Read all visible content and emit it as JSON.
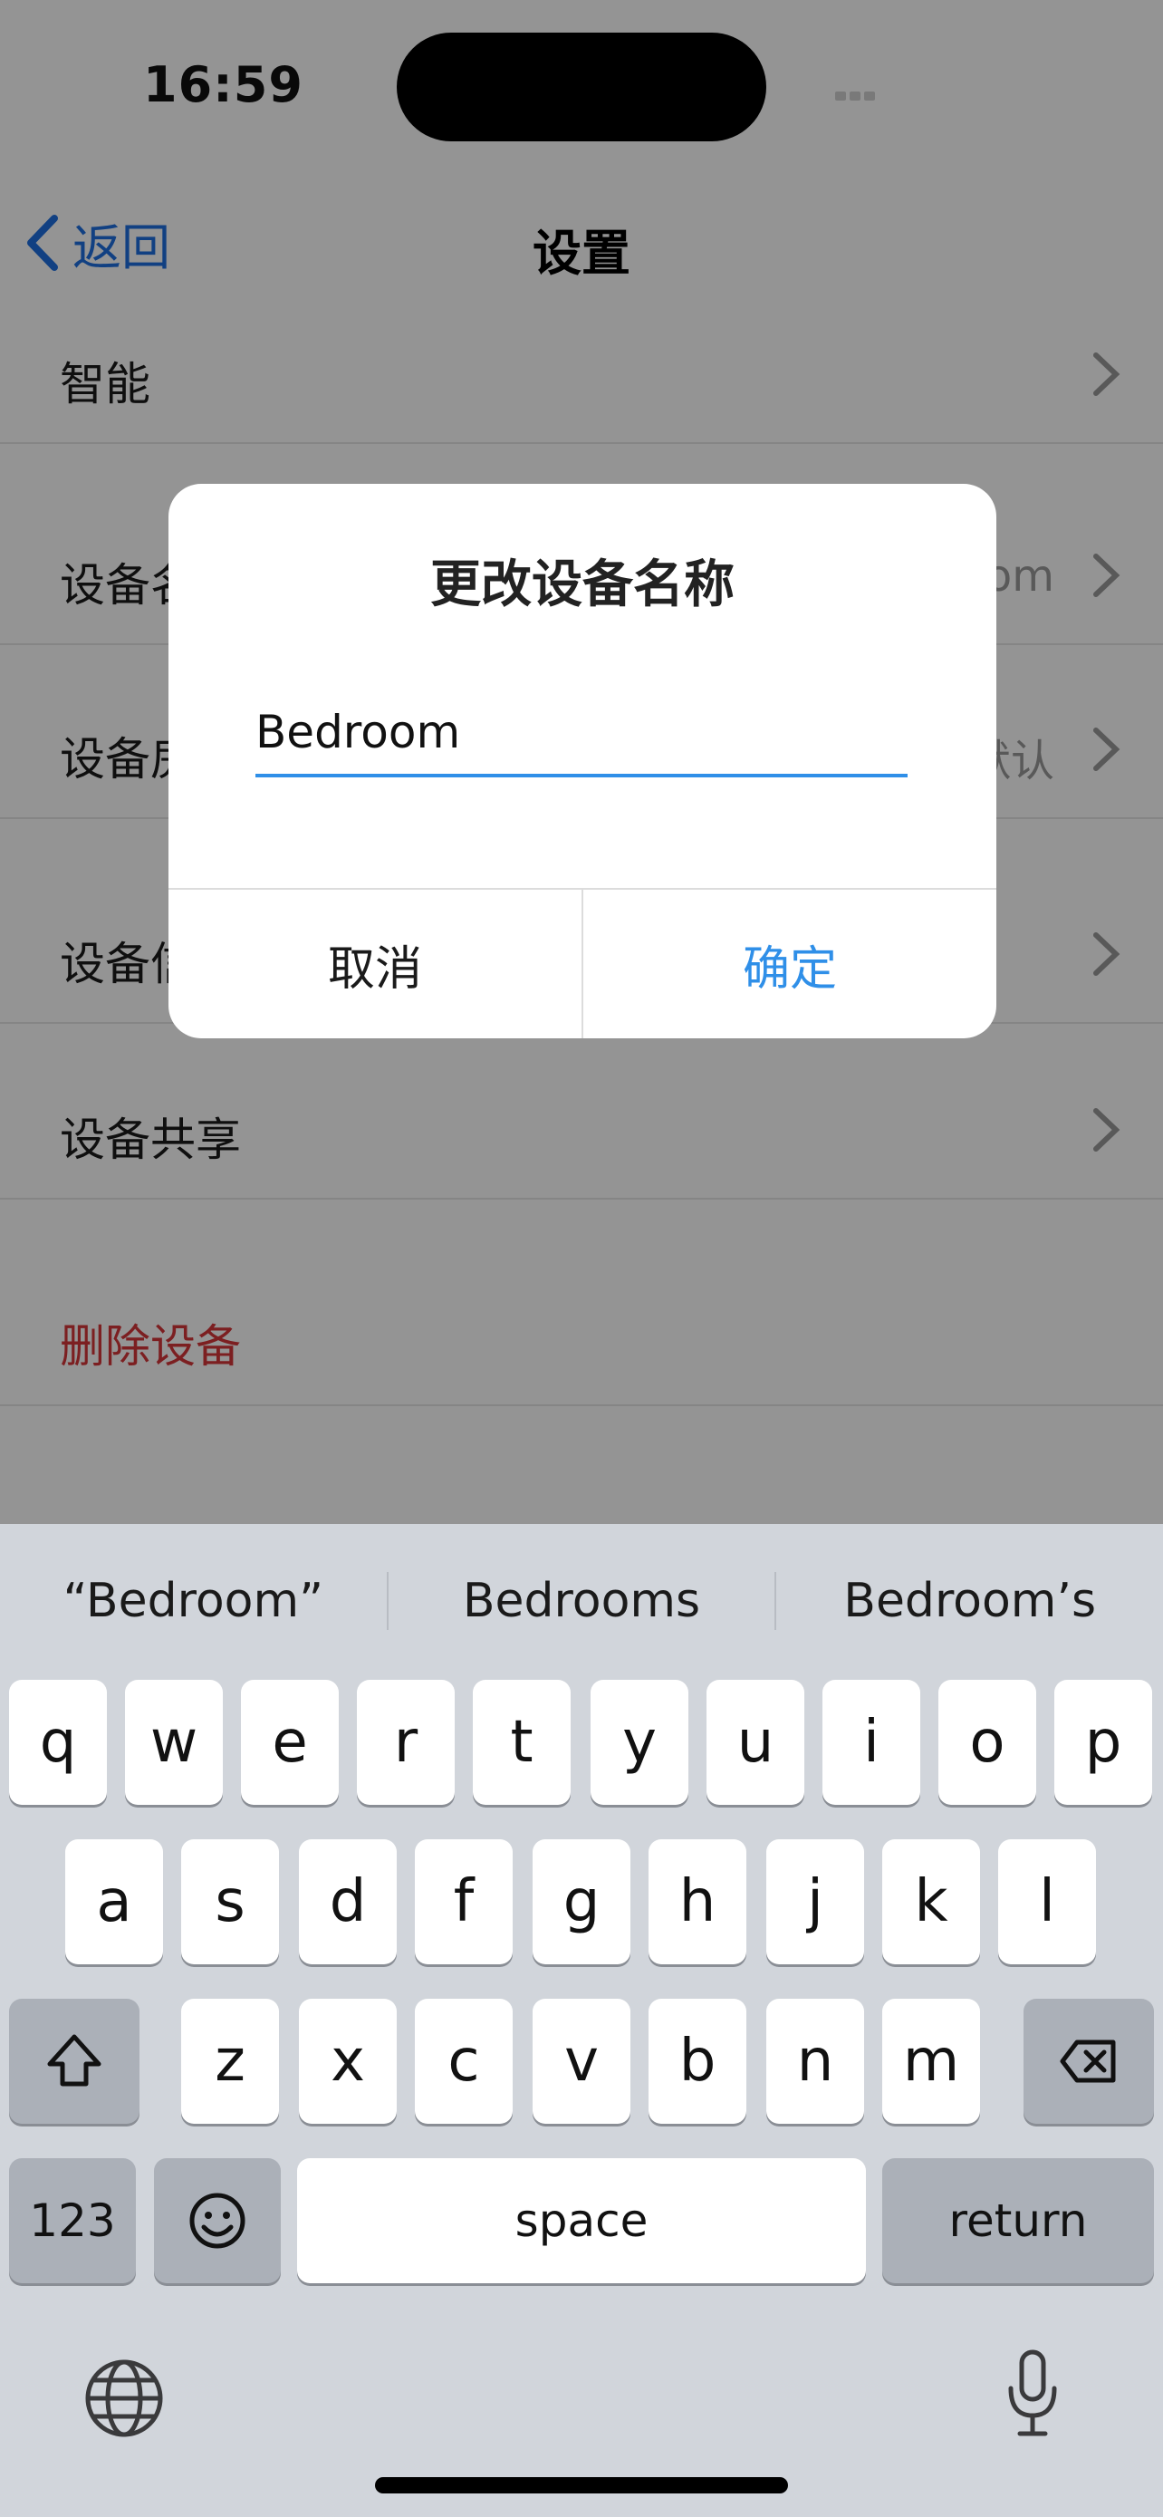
{
  "status_bar": {
    "time": "16:59"
  },
  "nav": {
    "back_label": "返回",
    "title": "设置"
  },
  "settings_rows": [
    {
      "label": "智能",
      "value": ""
    },
    {
      "label": "设备名称",
      "value": "Bedroom"
    },
    {
      "label": "设备房间",
      "value": "默认"
    },
    {
      "label": "设备信息",
      "value": ""
    },
    {
      "label": "设备共享",
      "value": ""
    },
    {
      "label": "删除设备",
      "value": ""
    }
  ],
  "dialog": {
    "title": "更改设备名称",
    "input_value": "Bedroom",
    "cancel_label": "取消",
    "confirm_label": "确定"
  },
  "keyboard": {
    "suggestions": [
      "“Bedroom”",
      "Bedrooms",
      "Bedroom’s"
    ],
    "row1": [
      "q",
      "w",
      "e",
      "r",
      "t",
      "y",
      "u",
      "i",
      "o",
      "p"
    ],
    "row2": [
      "a",
      "s",
      "d",
      "f",
      "g",
      "h",
      "j",
      "k",
      "l"
    ],
    "row3": [
      "z",
      "x",
      "c",
      "v",
      "b",
      "n",
      "m"
    ],
    "numbers_label": "123",
    "space_label": "space",
    "return_label": "return"
  },
  "colors": {
    "accent": "#2f8fe8",
    "back_link": "#1e6fe0",
    "destructive": "#d6363a",
    "keyboard_bg": "#d1d5db"
  }
}
